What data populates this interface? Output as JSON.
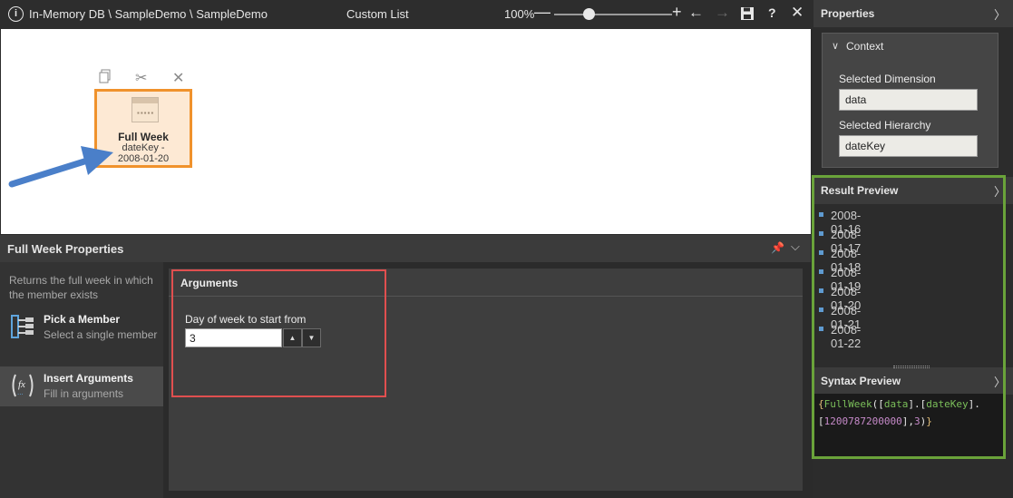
{
  "titlebar": {
    "path": "In-Memory DB \\ SampleDemo \\ SampleDemo",
    "title": "Custom List",
    "zoom": "100%",
    "zoom_level": 0.25
  },
  "canvas": {
    "node": {
      "name": "Full Week",
      "sub1": "dateKey -",
      "sub2": "2008-01-20"
    }
  },
  "props": {
    "title": "Full Week Properties",
    "description": "Returns the full week in which the member exists",
    "nav": [
      {
        "title": "Pick a Member",
        "subtitle": "Select a single member"
      },
      {
        "title": "Insert Arguments",
        "subtitle": "Fill in arguments"
      }
    ],
    "arguments": {
      "header": "Arguments",
      "day_label": "Day of week to start from",
      "day_value": "3"
    }
  },
  "right": {
    "properties_title": "Properties",
    "context_title": "Context",
    "selected_dimension_label": "Selected Dimension",
    "selected_dimension_value": "data",
    "selected_hierarchy_label": "Selected Hierarchy",
    "selected_hierarchy_value": "dateKey",
    "result_title": "Result Preview",
    "results": [
      "2008-01-16",
      "2008-01-17",
      "2008-01-18",
      "2008-01-19",
      "2008-01-20",
      "2008-01-21",
      "2008-01-22"
    ],
    "syntax_title": "Syntax Preview",
    "syntax": {
      "open_brace": "{",
      "fn": "FullWeek",
      "p1": "([",
      "dim": "data",
      "p2": "].[",
      "hier": "dateKey",
      "p3": "].",
      "p4": "[",
      "key": "1200787200000",
      "p5": "],",
      "arg": "3",
      "p6": ")",
      "close_brace": "}"
    }
  },
  "colors": {
    "node_border": "#f0922c",
    "node_fill": "#fde9d4",
    "annotation_red": "#e04f4f",
    "annotation_green": "#6aa33a",
    "arrow_blue": "#4a7fc9"
  }
}
